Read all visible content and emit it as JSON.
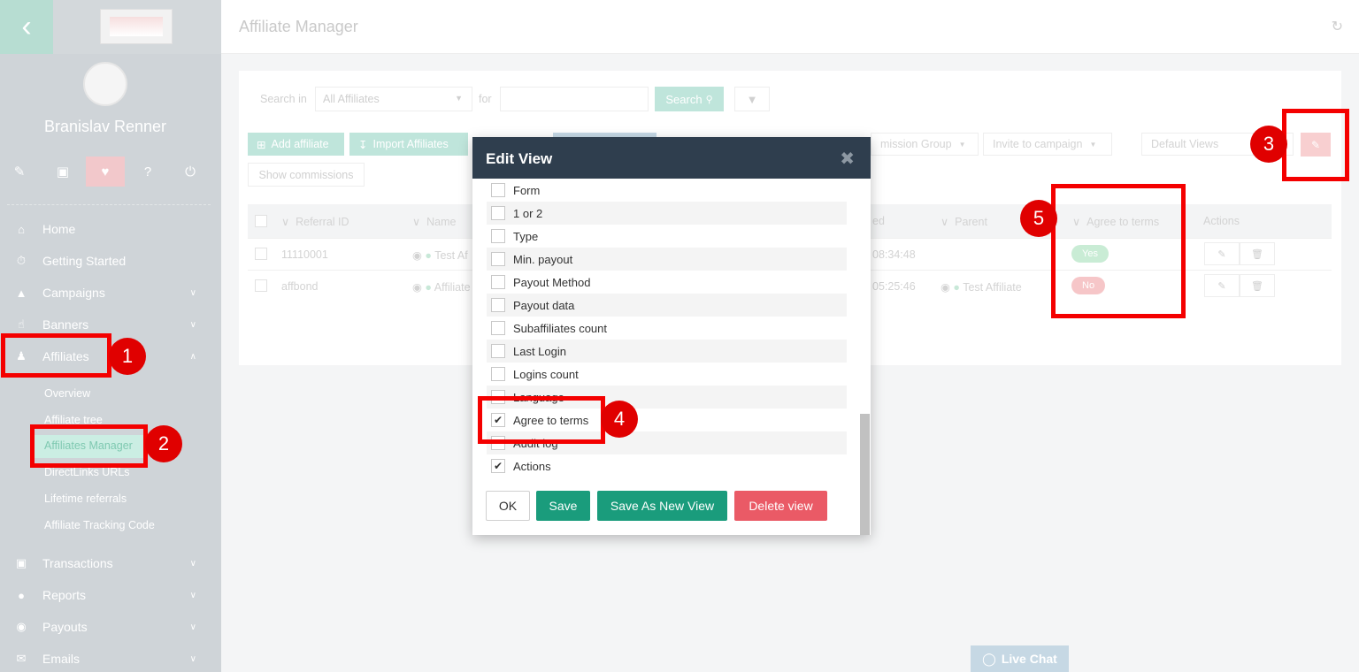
{
  "sidebar": {
    "back_icon": "chevron-left-icon",
    "user_name": "Branislav Renner",
    "icons": [
      "pencil-icon",
      "monitor-icon",
      "heart-icon",
      "question-icon",
      "power-icon"
    ],
    "nav": [
      {
        "label": "Home",
        "icon": "home-icon"
      },
      {
        "label": "Getting Started",
        "icon": "stopwatch-icon"
      },
      {
        "label": "Campaigns",
        "icon": "megaphone-icon"
      },
      {
        "label": "Banners",
        "icon": "hand-icon"
      },
      {
        "label": "Affiliates",
        "icon": "users-icon"
      },
      {
        "label": "Transactions",
        "icon": "basket-icon"
      },
      {
        "label": "Reports",
        "icon": "pie-icon"
      },
      {
        "label": "Payouts",
        "icon": "moneybag-icon"
      },
      {
        "label": "Emails",
        "icon": "envelope-icon"
      }
    ],
    "sub_items": [
      "Overview",
      "Affiliate tree",
      "Affiliates Manager",
      "DirectLinks URLs",
      "Lifetime referrals",
      "Affiliate Tracking Code"
    ]
  },
  "header": {
    "title": "Affiliate Manager"
  },
  "search": {
    "search_in_label": "Search in",
    "scope_value": "All Affiliates",
    "for_label": "for",
    "button_label": "Search"
  },
  "toolbar": {
    "add_affiliate": "Add affiliate",
    "import_affiliates": "Import Affiliates",
    "commission_group": "mission Group",
    "invite_campaign": "Invite to campaign",
    "default_views": "Default Views",
    "show_commissions": "Show commissions"
  },
  "table": {
    "headers": [
      "Referral ID",
      "Name",
      "ed",
      "Parent",
      "Agree to terms",
      "Actions"
    ],
    "rows": [
      {
        "referral_id": "11110001",
        "name": "Test Af",
        "time": "08:34:48",
        "parent": "",
        "agree": "Yes"
      },
      {
        "referral_id": "affbond",
        "name": "Affiliate",
        "time": "05:25:46",
        "parent": "Test Affiliate",
        "agree": "No"
      }
    ]
  },
  "modal": {
    "title": "Edit View",
    "items": [
      {
        "label": "Form",
        "checked": false
      },
      {
        "label": "1 or 2",
        "checked": false
      },
      {
        "label": "Type",
        "checked": false
      },
      {
        "label": "Min. payout",
        "checked": false
      },
      {
        "label": "Payout Method",
        "checked": false
      },
      {
        "label": "Payout data",
        "checked": false
      },
      {
        "label": "Subaffiliates count",
        "checked": false
      },
      {
        "label": "Last Login",
        "checked": false
      },
      {
        "label": "Logins count",
        "checked": false
      },
      {
        "label": "Language",
        "checked": false
      },
      {
        "label": "Agree to terms",
        "checked": true
      },
      {
        "label": "Audit log",
        "checked": false
      },
      {
        "label": "Actions",
        "checked": true
      }
    ],
    "ok_label": "OK",
    "save_label": "Save",
    "save_new_label": "Save As New View",
    "delete_label": "Delete view"
  },
  "annotations": [
    "1",
    "2",
    "3",
    "4",
    "5"
  ],
  "live_chat": "Live Chat",
  "colors": {
    "annotation_red": "#f40000",
    "modal_header": "#2f3e4e",
    "save_green": "#1a9c7c",
    "delete_red": "#ea5a66"
  }
}
